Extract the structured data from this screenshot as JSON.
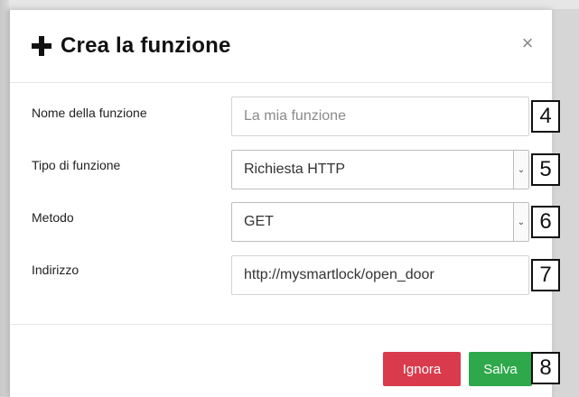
{
  "dialog": {
    "title": "Crea la funzione",
    "close_icon": "close-icon",
    "plus_icon": "plus-icon",
    "close_glyph": "×"
  },
  "form": {
    "name": {
      "label": "Nome della funzione",
      "placeholder": "La mia funzione",
      "value": ""
    },
    "type": {
      "label": "Tipo di funzione",
      "selected": "Richiesta HTTP"
    },
    "method": {
      "label": "Metodo",
      "selected": "GET"
    },
    "address": {
      "label": "Indirizzo",
      "value": "http://mysmartlock/open_door"
    }
  },
  "footer": {
    "ignore_label": "Ignora",
    "save_label": "Salva"
  },
  "callouts": [
    "4",
    "5",
    "6",
    "7",
    "8"
  ],
  "colors": {
    "ignore_button": "#d93a4c",
    "save_button": "#2ea84a"
  }
}
